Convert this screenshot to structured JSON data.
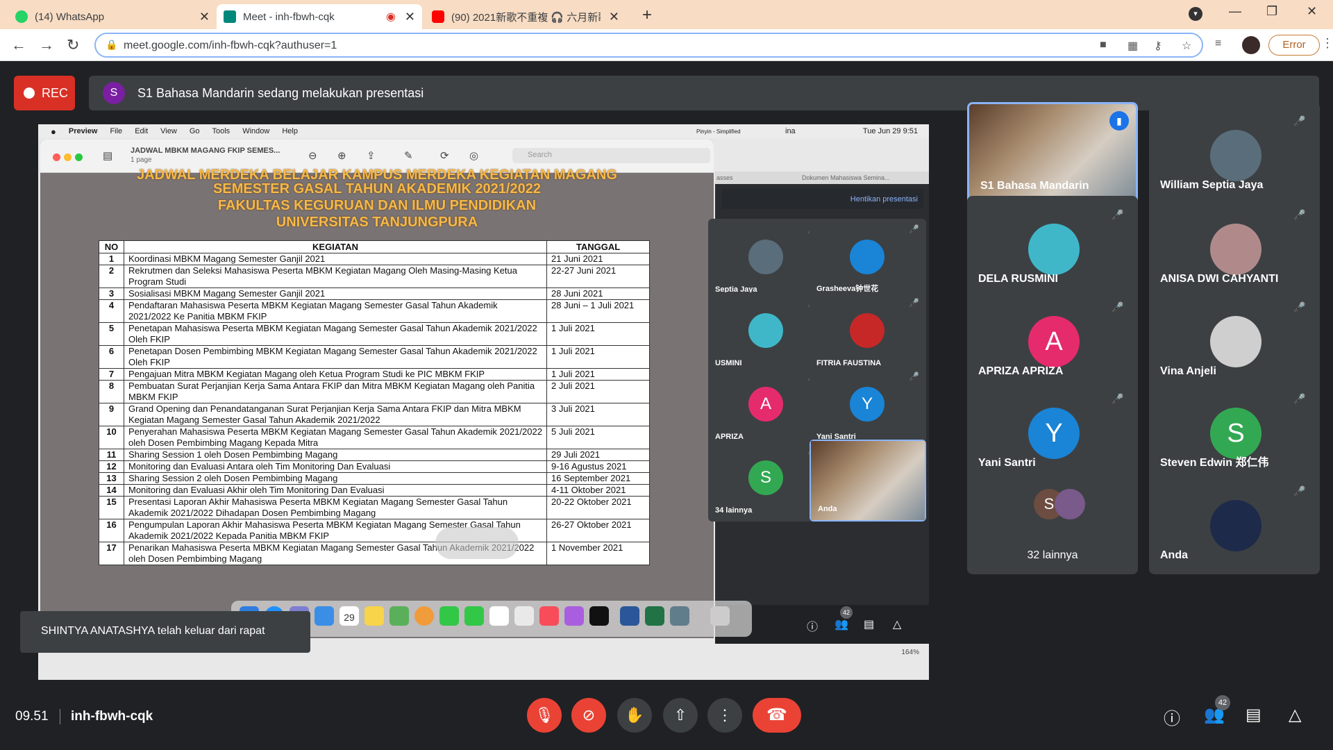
{
  "browser": {
    "tabs": [
      {
        "label": "(14) WhatsApp",
        "color": "#25d366"
      },
      {
        "label": "Meet - inh-fbwh-cqk",
        "color": "#00897b"
      },
      {
        "label": "(90) 2021新歌不重複 🎧 六月新歌",
        "color": "#ff0000"
      }
    ],
    "url": "meet.google.com/inh-fbwh-cqk?authuser=1",
    "error_label": "Error"
  },
  "meet": {
    "rec_label": "REC",
    "presenter_initial": "S",
    "presenting_text": "S1 Bahasa Mandarin sedang melakukan presentasi",
    "time": "09.51",
    "meeting_code": "inh-fbwh-cqk",
    "participants_count": "42",
    "toast": "SHINTYA ANATASHYA telah keluar dari rapat",
    "tiles": [
      {
        "name": "S1 Bahasa Mandarin",
        "type": "video",
        "speaking": true
      },
      {
        "name": "William Septia Jaya",
        "type": "photo",
        "color": "#5a6d7a"
      },
      {
        "name": "DELA RUSMINI",
        "type": "photo",
        "color": "#3fb7c9"
      },
      {
        "name": "ANISA DWI CAHYANTI",
        "type": "photo",
        "color": "#b08a8a"
      },
      {
        "name": "APRIZA APRIZA",
        "type": "initial",
        "initial": "A",
        "color": "#e52b6b"
      },
      {
        "name": "Vina Anjeli",
        "type": "photo",
        "color": "#cfcfcf"
      },
      {
        "name": "Yani Santri",
        "type": "initial",
        "initial": "Y",
        "color": "#1a84d6"
      },
      {
        "name": "Steven Edwin 郑仁伟",
        "type": "initial",
        "initial": "S",
        "color": "#33a853"
      },
      {
        "name": "32 lainnya",
        "type": "others",
        "initial": "S",
        "color": "#6d4c41"
      },
      {
        "name": "Anda",
        "type": "photo",
        "color": "#1d2a4a"
      }
    ]
  },
  "shared_screen": {
    "mac_menu": [
      "Preview",
      "File",
      "Edit",
      "View",
      "Go",
      "Tools",
      "Window",
      "Help"
    ],
    "mac_clock": "Tue Jun 29  9:51",
    "mac_status": "Pinyin - Simplified",
    "mac_user": "ina",
    "preview_title": "JADWAL MBKM MAGANG FKIP SEMES...",
    "preview_pages": "1 page",
    "search_placeholder": "Search",
    "doc_heading": [
      "JADWAL MERDEKA BELAJAR KAMPUS MERDEKA KEGIATAN MAGANG",
      "SEMESTER GASAL TAHUN AKADEMIK 2021/2022",
      "FAKULTAS KEGURUAN DAN ILMU PENDIDIKAN",
      "UNIVERSITAS TANJUNGPURA"
    ],
    "table_headers": [
      "NO",
      "KEGIATAN",
      "TANGGAL"
    ],
    "rows": [
      {
        "no": "1",
        "kegiatan": "Koordinasi MBKM Magang Semester Ganjil 2021",
        "tanggal": "21 Juni 2021"
      },
      {
        "no": "2",
        "kegiatan": "Rekrutmen dan Seleksi Mahasiswa Peserta MBKM Kegiatan Magang Oleh Masing-Masing Ketua Program Studi",
        "tanggal": "22-27 Juni 2021"
      },
      {
        "no": "3",
        "kegiatan": "Sosialisasi MBKM Magang Semester Ganjil 2021",
        "tanggal": "28 Juni 2021"
      },
      {
        "no": "4",
        "kegiatan": "Pendaftaran Mahasiswa Peserta MBKM Kegiatan Magang Semester Gasal Tahun Akademik 2021/2022 Ke Panitia MBKM FKIP",
        "tanggal": "28 Juni – 1 Juli 2021"
      },
      {
        "no": "5",
        "kegiatan": "Penetapan Mahasiswa Peserta MBKM Kegiatan Magang Semester Gasal Tahun Akademik 2021/2022 Oleh FKIP",
        "tanggal": "1 Juli 2021"
      },
      {
        "no": "6",
        "kegiatan": "Penetapan Dosen Pembimbing MBKM Kegiatan Magang Semester Gasal Tahun Akademik 2021/2022 Oleh FKIP",
        "tanggal": "1 Juli 2021"
      },
      {
        "no": "7",
        "kegiatan": "Pengajuan Mitra MBKM Kegiatan Magang oleh Ketua Program Studi ke PIC MBKM FKIP",
        "tanggal": "1 Juli 2021"
      },
      {
        "no": "8",
        "kegiatan": "Pembuatan Surat Perjanjian Kerja Sama Antara FKIP dan Mitra MBKM Kegiatan Magang oleh Panitia MBKM FKIP",
        "tanggal": "2 Juli 2021"
      },
      {
        "no": "9",
        "kegiatan": "Grand Opening dan Penandatanganan Surat Perjanjian Kerja Sama Antara FKIP dan Mitra MBKM Kegiatan Magang Semester Gasal Tahun Akademik 2021/2022",
        "tanggal": "3 Juli 2021"
      },
      {
        "no": "10",
        "kegiatan": "Penyerahan Mahasiswa Peserta MBKM Kegiatan Magang Semester Gasal Tahun Akademik 2021/2022 oleh Dosen Pembimbing Magang Kepada Mitra",
        "tanggal": "5 Juli 2021"
      },
      {
        "no": "11",
        "kegiatan": "Sharing Session 1 oleh Dosen Pembimbing Magang",
        "tanggal": "29 Juli 2021"
      },
      {
        "no": "12",
        "kegiatan": "Monitoring dan Evaluasi Antara oleh Tim Monitoring Dan Evaluasi",
        "tanggal": "9-16 Agustus 2021"
      },
      {
        "no": "13",
        "kegiatan": "Sharing Session 2 oleh Dosen Pembimbing Magang",
        "tanggal": "16 September 2021"
      },
      {
        "no": "14",
        "kegiatan": "Monitoring dan Evaluasi Akhir oleh Tim Monitoring Dan Evaluasi",
        "tanggal": "4-11 Oktober 2021"
      },
      {
        "no": "15",
        "kegiatan": "Presentasi Laporan Akhir Mahasiswa Peserta MBKM Kegiatan Magang Semester Gasal Tahun Akademik 2021/2022 Dihadapan Dosen Pembimbing Magang",
        "tanggal": "20-22 Oktober 2021"
      },
      {
        "no": "16",
        "kegiatan": "Pengumpulan Laporan Akhir Mahasiswa Peserta MBKM Kegiatan Magang Semester Gasal Tahun Akademik 2021/2022 Kepada Panitia MBKM FKIP",
        "tanggal": "26-27 Oktober 2021"
      },
      {
        "no": "17",
        "kegiatan": "Penarikan Mahasiswa Peserta MBKM Kegiatan Magang Semester Gasal Tahun Akademik 2021/2022 oleh Dosen Pembimbing Magang",
        "tanggal": "1 November 2021"
      }
    ],
    "mini_meet": {
      "tab1": "asses",
      "tab2": "Dokumen Mahasiswa Semina...",
      "stop_presenting": "Hentikan presentasi",
      "tiles": [
        {
          "name": "Septia Jaya",
          "color": "#5a6d7a"
        },
        {
          "name": "Grasheeva钟世花",
          "color": "#1a84d6"
        },
        {
          "name": "USMINI",
          "color": "#3fb7c9"
        },
        {
          "name": "FITRIA FAUSTINA",
          "color": "#c62828"
        },
        {
          "name": "APRIZA",
          "initial": "A",
          "color": "#e52b6b"
        },
        {
          "name": "Yani Santri",
          "initial": "Y",
          "color": "#1a84d6"
        },
        {
          "name": "34 lainnya",
          "initial": "S",
          "color": "#33a853"
        },
        {
          "name": "Anda",
          "color": "#7a6a5a"
        }
      ],
      "count": "42",
      "zoom": "164%"
    },
    "dock_date": "29"
  }
}
